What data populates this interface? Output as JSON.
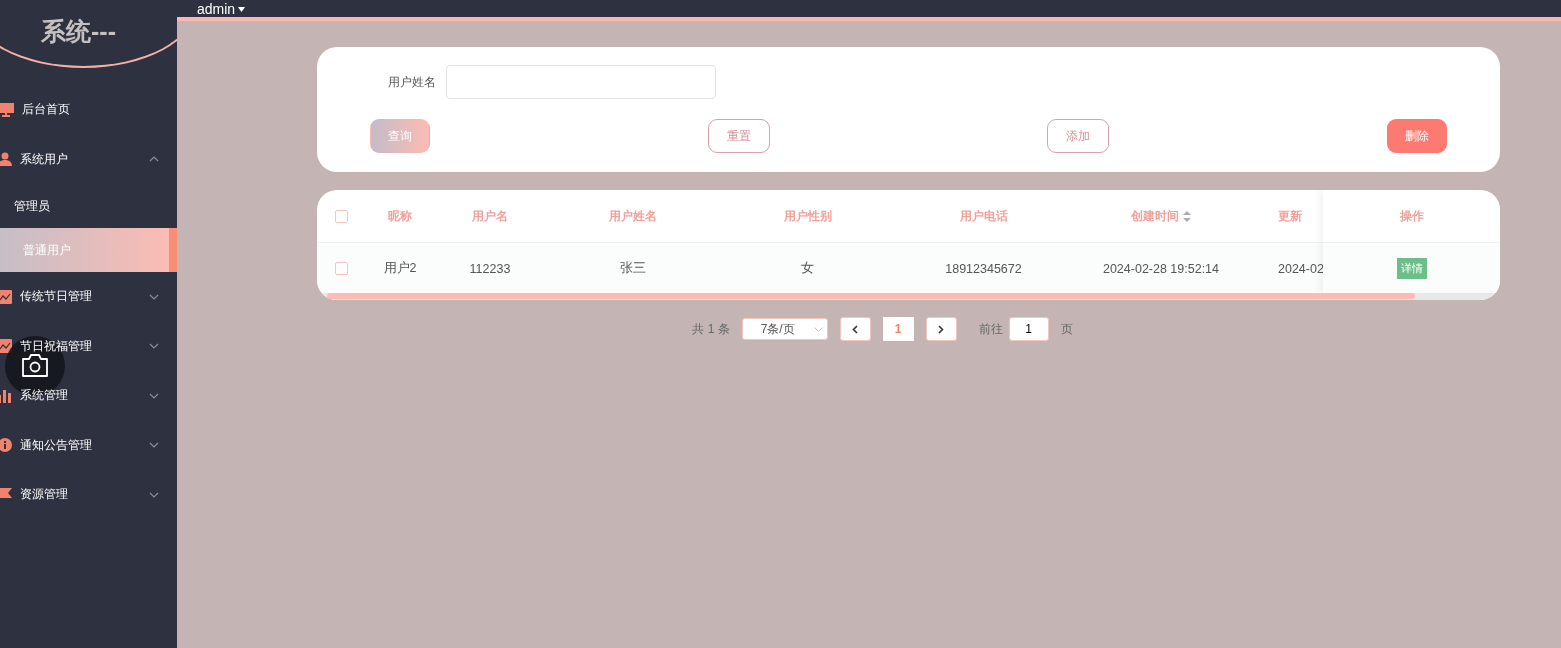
{
  "sidebar": {
    "title": "系统---",
    "items": [
      {
        "label": "后台首页"
      },
      {
        "label": "系统用户",
        "expanded": true,
        "children": [
          {
            "label": "管理员",
            "selected": false
          },
          {
            "label": "普通用户",
            "selected": true
          }
        ]
      },
      {
        "label": "传统节日管理",
        "expanded": false
      },
      {
        "label": "节日祝福管理",
        "expanded": false
      },
      {
        "label": "系统管理",
        "expanded": false
      },
      {
        "label": "通知公告管理",
        "expanded": false
      },
      {
        "label": "资源管理",
        "expanded": false
      }
    ]
  },
  "topbar": {
    "user": "admin"
  },
  "search": {
    "label": "用户姓名",
    "buttons": [
      {
        "label": "查询",
        "kind": "primary"
      },
      {
        "label": "重置",
        "kind": "outline"
      },
      {
        "label": "添加",
        "kind": "outline"
      },
      {
        "label": "删除",
        "kind": "danger"
      }
    ]
  },
  "table": {
    "columns": [
      {
        "label": "昵称"
      },
      {
        "label": "用户名"
      },
      {
        "label": "用户姓名"
      },
      {
        "label": "用户性别"
      },
      {
        "label": "用户电话"
      },
      {
        "label": "创建时间",
        "sortable": true
      },
      {
        "label": "更新"
      }
    ],
    "action_column": "操作",
    "all_checked": false,
    "rows": [
      {
        "checked": false,
        "cells": [
          "用户2",
          "112233",
          "张三",
          "女",
          "18912345672",
          "2024-02-28 19:52:14",
          "2024-02"
        ],
        "action": "详情"
      }
    ]
  },
  "pagination": {
    "total": "共 1 条",
    "page_size": "7条/页",
    "current": "1",
    "goto_label": "前往",
    "goto_value": "1",
    "page_suffix": "页"
  }
}
